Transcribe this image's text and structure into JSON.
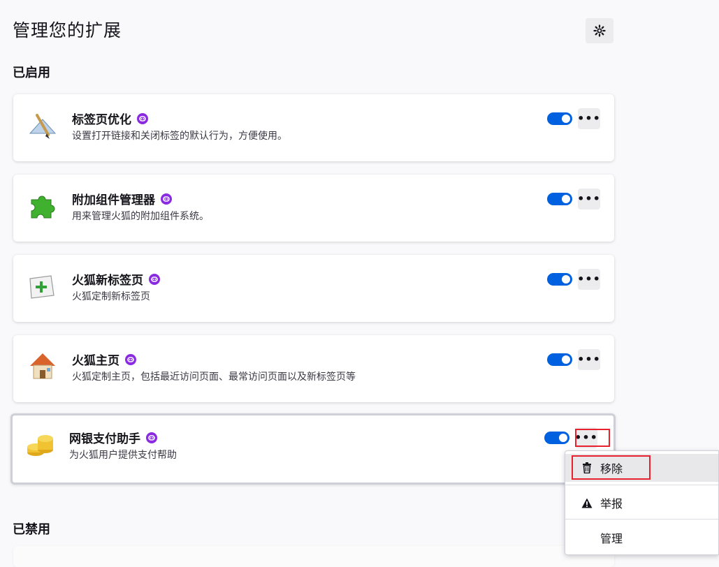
{
  "header": {
    "title": "管理您的扩展",
    "settings_icon": "gear-icon"
  },
  "sections": {
    "enabled_title": "已启用",
    "disabled_title": "已禁用"
  },
  "extensions": [
    {
      "name": "标签页优化",
      "description": "设置打开链接和关闭标签的默认行为，方便使用。",
      "icon": "tab-optimize-icon",
      "enabled": true
    },
    {
      "name": "附加组件管理器",
      "description": "用来管理火狐的附加组件系统。",
      "icon": "puzzle-piece-icon",
      "enabled": true
    },
    {
      "name": "火狐新标签页",
      "description": "火狐定制新标签页",
      "icon": "new-tab-icon",
      "enabled": true
    },
    {
      "name": "火狐主页",
      "description": "火狐定制主页，包括最近访问页面、最常访问页面以及新标签页等",
      "icon": "house-icon",
      "enabled": true
    },
    {
      "name": "网银支付助手",
      "description": "为火狐用户提供支付帮助",
      "icon": "coins-icon",
      "enabled": true
    }
  ],
  "more_button_label": "•••",
  "context_menu": {
    "items": [
      {
        "label": "移除",
        "icon": "trash-icon"
      },
      {
        "label": "举报",
        "icon": "warning-icon"
      },
      {
        "label": "管理",
        "icon": ""
      }
    ]
  },
  "colors": {
    "accent": "#0061e0",
    "badge": "#8a2be2",
    "highlight": "#e8212e"
  }
}
